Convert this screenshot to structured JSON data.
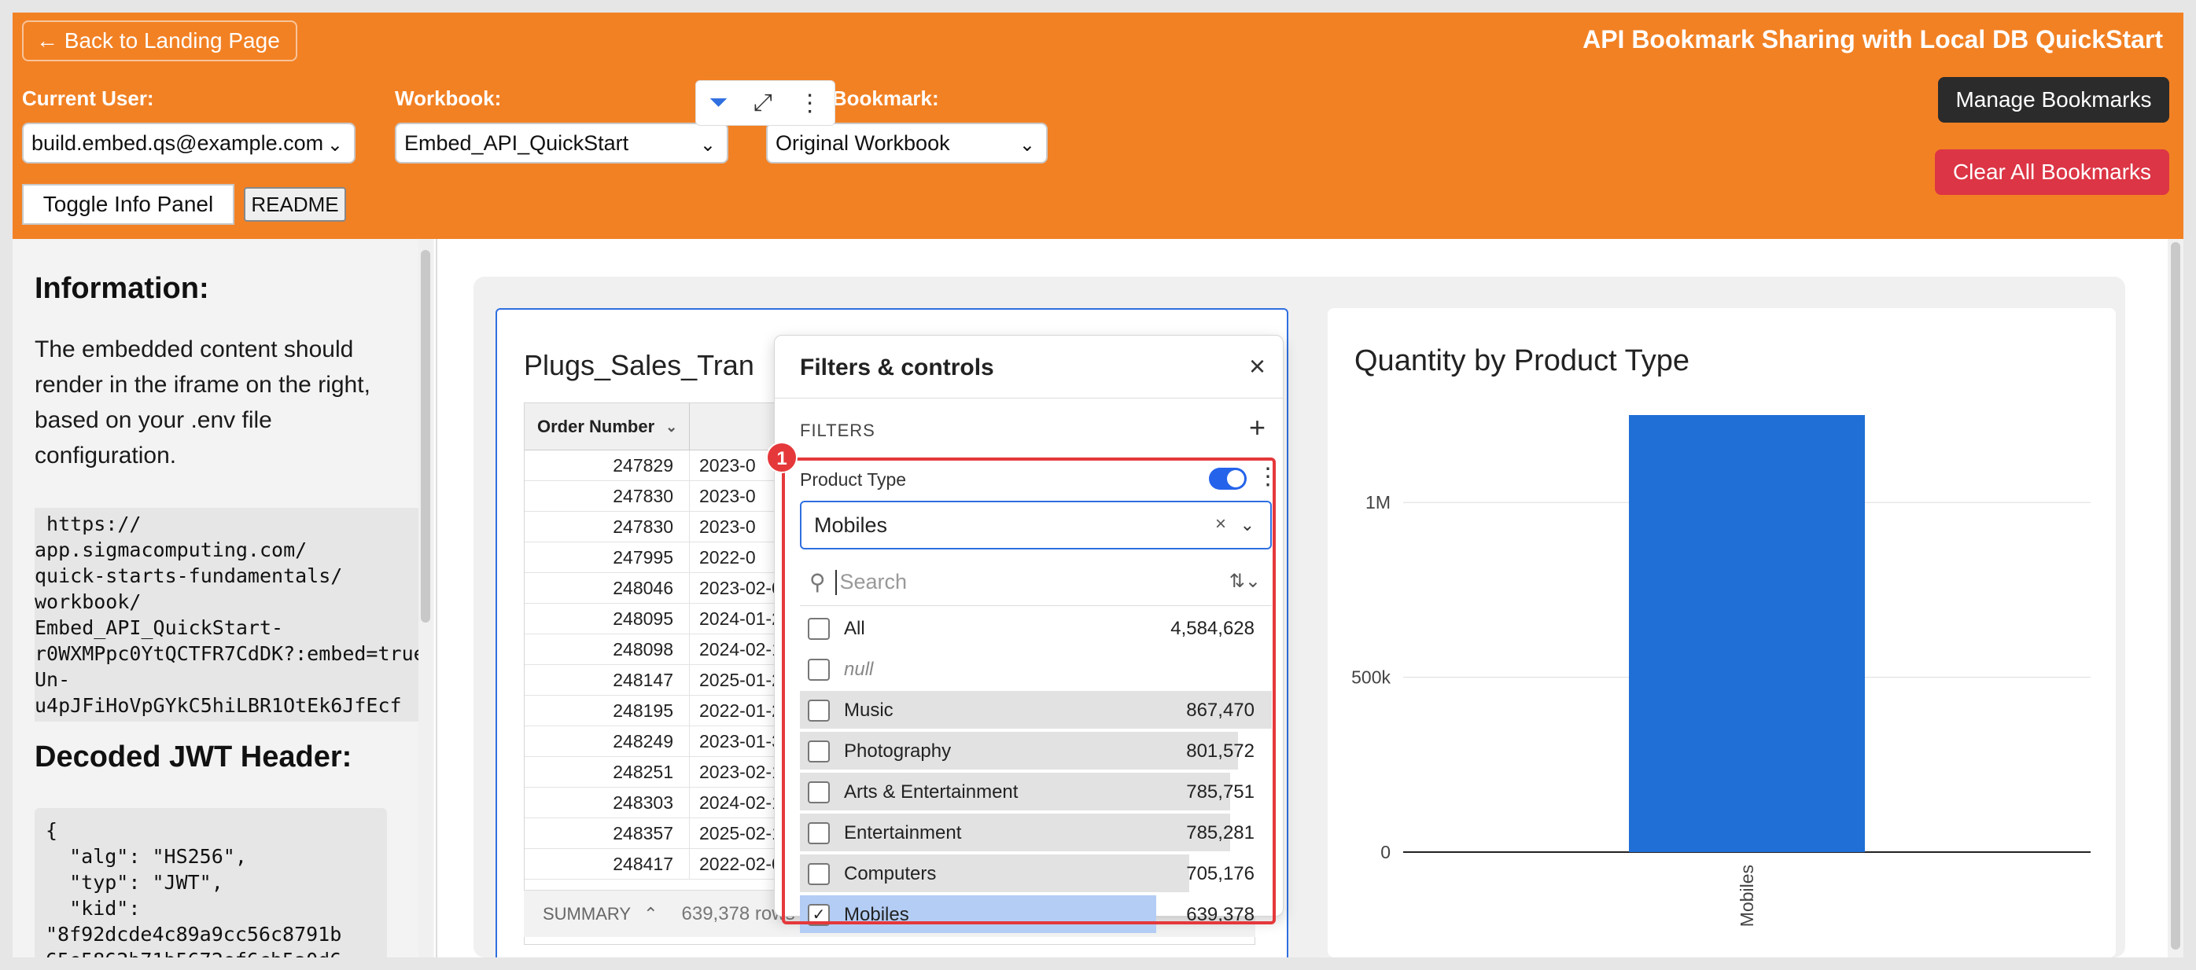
{
  "header": {
    "back_label": "← Back to Landing Page",
    "title": "API Bookmark Sharing with Local DB QuickStart",
    "current_user_label": "Current User:",
    "current_user_value": "build.embed.qs@example.com",
    "workbook_label": "Workbook:",
    "workbook_value": "Embed_API_QuickStart",
    "saved_bookmark_label": "Saved Bookmark:",
    "saved_bookmark_value": "Original Workbook",
    "toggle_info_label": "Toggle Info Panel",
    "readme_label": "README",
    "manage_bookmarks_label": "Manage Bookmarks",
    "clear_bookmarks_label": "Clear All Bookmarks"
  },
  "info_panel": {
    "heading": "Information:",
    "paragraph": "The embedded content should render in the iframe on the right, based on your .env file configuration.",
    "url": " https://\napp.sigmacomputing.com/\nquick-starts-fundamentals/\nworkbook/\nEmbed_API_QuickStart-\nr0WXMPpc0YtQCTFR7CdDK?:embed=true&:\nUn-\nu4pJFiHoVpGYkC5hiLBR1OtEk6JfEcf",
    "jwt_heading": "Decoded JWT Header:",
    "jwt_json": "{\n  \"alg\": \"HS256\",\n  \"typ\": \"JWT\",\n  \"kid\":\n\"8f92dcde4c89a9cc56c8791b\n65e5862b71b5672ef6cb5a0d6"
  },
  "table": {
    "title": "Plugs_Sales_Tran",
    "column_header": "Order Number",
    "rows": [
      {
        "order": "247829",
        "date": "2023-0"
      },
      {
        "order": "247830",
        "date": "2023-0"
      },
      {
        "order": "247830",
        "date": "2023-0"
      },
      {
        "order": "247995",
        "date": "2022-0"
      },
      {
        "order": "248046",
        "date": "2023-02-0"
      },
      {
        "order": "248095",
        "date": "2024-01-2"
      },
      {
        "order": "248098",
        "date": "2024-02-1"
      },
      {
        "order": "248147",
        "date": "2025-01-2"
      },
      {
        "order": "248195",
        "date": "2022-01-2"
      },
      {
        "order": "248249",
        "date": "2023-01-3"
      },
      {
        "order": "248251",
        "date": "2023-02-1"
      },
      {
        "order": "248303",
        "date": "2024-02-1"
      },
      {
        "order": "248357",
        "date": "2025-02-1"
      },
      {
        "order": "248417",
        "date": "2022-02-0"
      }
    ],
    "summary_label": "SUMMARY",
    "rows_count": "639,378 rows"
  },
  "filter_panel": {
    "title": "Filters & controls",
    "filters_label": "FILTERS",
    "filter_name": "Product Type",
    "selected_value": "Mobiles",
    "search_placeholder": "Search",
    "options": [
      {
        "name": "All",
        "count": "4,584,628",
        "fraction": 0,
        "checked": false
      },
      {
        "name": "null",
        "count": "",
        "fraction": 0,
        "checked": false,
        "is_null": true
      },
      {
        "name": "Music",
        "count": "867,470",
        "fraction": 1.0,
        "checked": false
      },
      {
        "name": "Photography",
        "count": "801,572",
        "fraction": 0.924,
        "checked": false
      },
      {
        "name": "Arts & Entertainment",
        "count": "785,751",
        "fraction": 0.906,
        "checked": false
      },
      {
        "name": "Entertainment",
        "count": "785,281",
        "fraction": 0.905,
        "checked": false
      },
      {
        "name": "Computers",
        "count": "705,176",
        "fraction": 0.813,
        "checked": false
      },
      {
        "name": "Mobiles",
        "count": "639,378",
        "fraction": 0.737,
        "checked": true
      }
    ],
    "annotation_badge": "1",
    "colors": {
      "bar": "#e2e2e2",
      "selected_bar": "#b3cdf5",
      "highlight": "#e5383b",
      "toggle": "#2563eb"
    }
  },
  "chart_data": {
    "type": "bar",
    "title": "Quantity by Product Type",
    "categories": [
      "Mobiles"
    ],
    "values": [
      1250000
    ],
    "ylim": [
      0,
      1250000
    ],
    "yticks": [
      0,
      500000,
      1000000
    ],
    "ytick_labels": [
      "0",
      "500k",
      "1M"
    ],
    "grid": true,
    "color": "#1f6fd6"
  }
}
